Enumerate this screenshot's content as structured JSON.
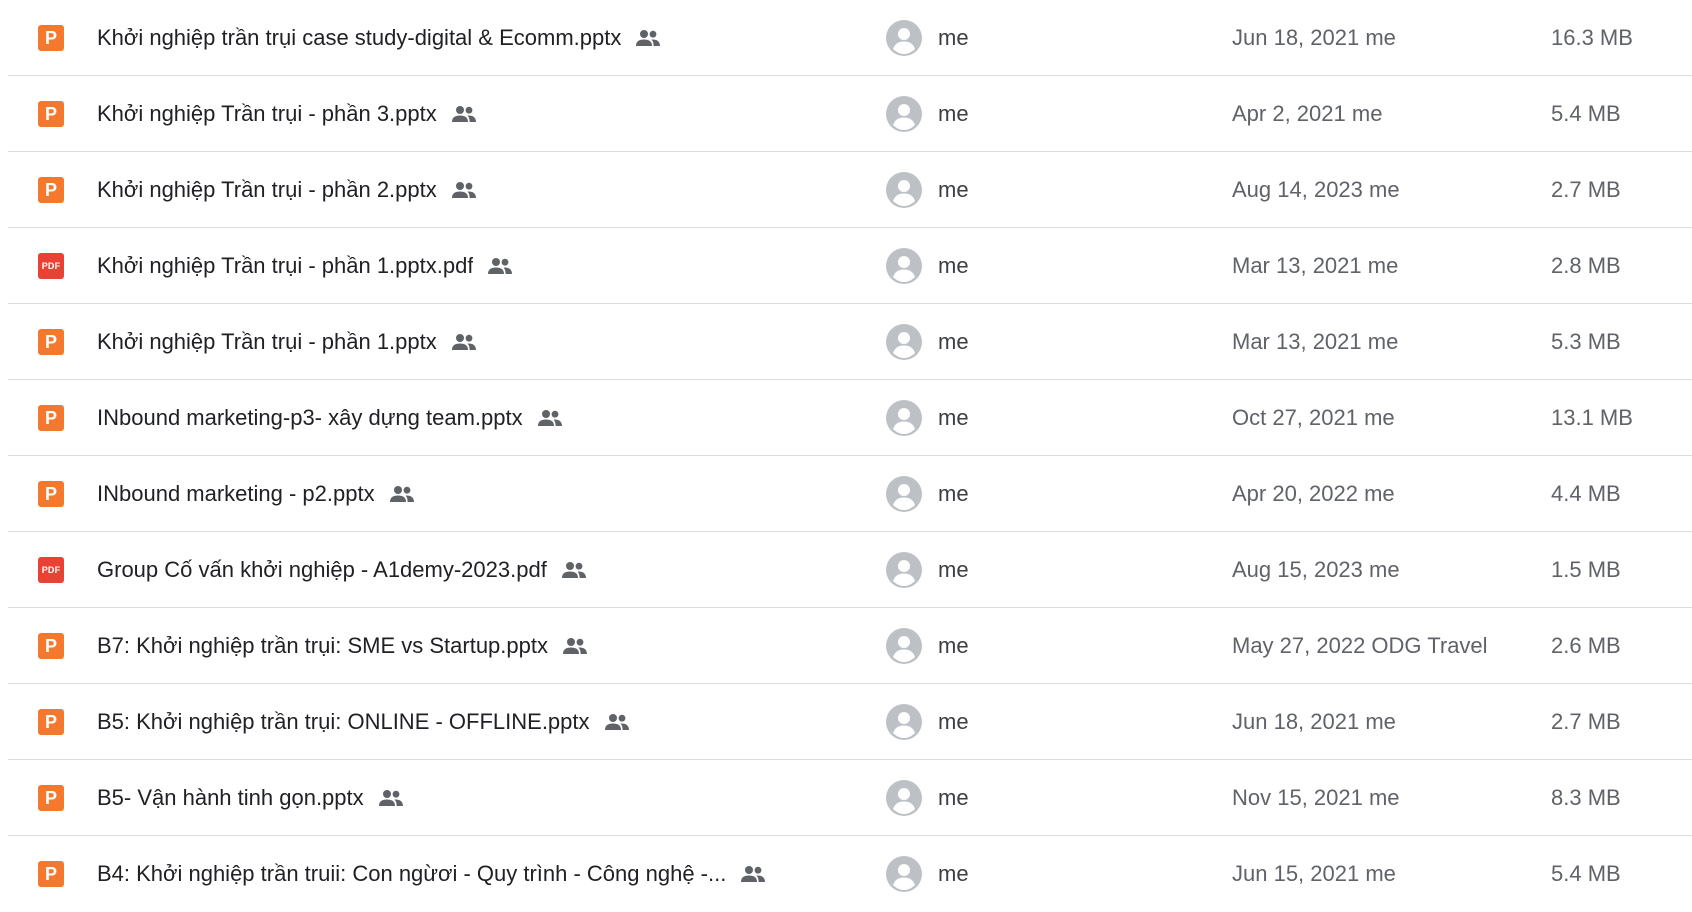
{
  "files": [
    {
      "name": "Khởi nghiệp trần trụi case study-digital & Ecomm.pptx",
      "type": "pptx",
      "icon_label": "P",
      "owner": "me",
      "modified": "Jun 18, 2021 me",
      "size": "16.3 MB"
    },
    {
      "name": "Khởi nghiệp Trần trụi - phần 3.pptx",
      "type": "pptx",
      "icon_label": "P",
      "owner": "me",
      "modified": "Apr 2, 2021 me",
      "size": "5.4 MB"
    },
    {
      "name": "Khởi nghiệp Trần trụi - phần 2.pptx",
      "type": "pptx",
      "icon_label": "P",
      "owner": "me",
      "modified": "Aug 14, 2023 me",
      "size": "2.7 MB"
    },
    {
      "name": "Khởi nghiệp Trần trụi - phần 1.pptx.pdf",
      "type": "pdf",
      "icon_label": "PDF",
      "owner": "me",
      "modified": "Mar 13, 2021 me",
      "size": "2.8 MB"
    },
    {
      "name": "Khởi nghiệp Trần trụi - phần 1.pptx",
      "type": "pptx",
      "icon_label": "P",
      "owner": "me",
      "modified": "Mar 13, 2021 me",
      "size": "5.3 MB"
    },
    {
      "name": "INbound marketing-p3- xây  dựng team.pptx",
      "type": "pptx",
      "icon_label": "P",
      "owner": "me",
      "modified": "Oct 27, 2021 me",
      "size": "13.1 MB"
    },
    {
      "name": "INbound marketing - p2.pptx",
      "type": "pptx",
      "icon_label": "P",
      "owner": "me",
      "modified": "Apr 20, 2022 me",
      "size": "4.4 MB"
    },
    {
      "name": "Group Cố vấn khởi nghiệp - A1demy-2023.pdf",
      "type": "pdf",
      "icon_label": "PDF",
      "owner": "me",
      "modified": "Aug 15, 2023 me",
      "size": "1.5 MB"
    },
    {
      "name": "B7: Khởi  nghiệp  trần  trụi: SME vs Startup.pptx",
      "type": "pptx",
      "icon_label": "P",
      "owner": "me",
      "modified": "May 27, 2022 ODG Travel",
      "size": "2.6 MB"
    },
    {
      "name": "B5: Khởi  nghiệp  trần  trụi: ONLINE - OFFLINE.pptx",
      "type": "pptx",
      "icon_label": "P",
      "owner": "me",
      "modified": "Jun 18, 2021 me",
      "size": "2.7 MB"
    },
    {
      "name": "B5- Vận hành tinh gọn.pptx",
      "type": "pptx",
      "icon_label": "P",
      "owner": "me",
      "modified": "Nov 15, 2021 me",
      "size": "8.3 MB"
    },
    {
      "name": "B4: Khởi  nghiệp  trần  truii: Con ngừơi  - Quy  trình  - Công  nghệ  -...",
      "type": "pptx",
      "icon_label": "P",
      "owner": "me",
      "modified": "Jun 15, 2021 me",
      "size": "5.4 MB"
    }
  ],
  "icons": {
    "shared": "shared-people-icon",
    "avatar": "default-avatar-icon"
  },
  "colors": {
    "pptx_icon": "#f4792f",
    "pdf_icon": "#e94235",
    "divider": "#dadce0",
    "avatar": "#bdc1c6",
    "shared_icon": "#5f6368"
  }
}
